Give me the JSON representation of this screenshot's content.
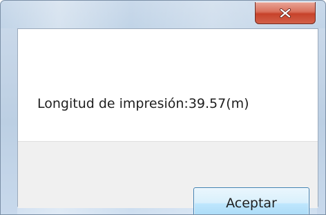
{
  "dialog": {
    "close_label": "x",
    "message": "Longitud de impresión:39.57(m)",
    "ok_label": "Aceptar"
  },
  "icons": {
    "close": "close-icon"
  },
  "colors": {
    "close_button": "#c7422a",
    "ok_button_border": "#3c7fb1",
    "footer_background": "#f0f0f0",
    "frame": "#b6cde3"
  }
}
